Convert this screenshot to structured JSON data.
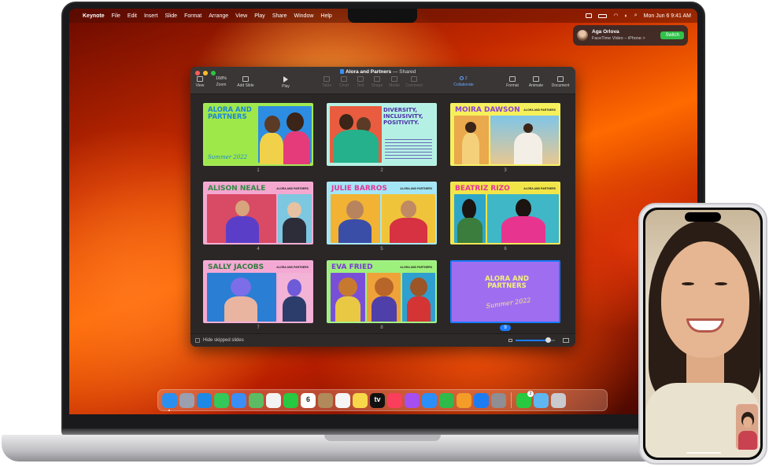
{
  "menubar": {
    "items": [
      "Keynote",
      "File",
      "Edit",
      "Insert",
      "Slide",
      "Format",
      "Arrange",
      "View",
      "Play",
      "Share",
      "Window",
      "Help"
    ],
    "datetime": "Mon Jun 6  9:41 AM"
  },
  "notification": {
    "name": "Aga Orlova",
    "subtitle": "FaceTime Video – iPhone >",
    "button": "Switch"
  },
  "keynote": {
    "title": "Alora and Partners",
    "shared": "— Shared",
    "zoom": "168%",
    "toolbar": {
      "view": "View",
      "zoom": "Zoom",
      "add_slide": "Add Slide",
      "play": "Play",
      "table": "Table",
      "chart": "Chart",
      "text": "Text",
      "shape": "Shape",
      "media": "Media",
      "comment": "Comment",
      "collab_count": "2",
      "collaborate": "Collaborate",
      "format": "Format",
      "animate": "Animate",
      "document": "Document"
    },
    "slides": [
      {
        "num": "1",
        "title": "ALORA AND PARTNERS",
        "caption": "Summer 2022",
        "bg": "#9ee84a",
        "title_color": "#1d86d8"
      },
      {
        "num": "2",
        "title": "DIVERSITY, INCLUSIVITY, POSITIVITY.",
        "bg": "#b4f1e4",
        "title_color": "#4a2fa6"
      },
      {
        "num": "3",
        "title": "MOIRA DAWSON",
        "tag": "ALORA AND PARTNERS",
        "bg": "#f6f05a",
        "title_color": "#8b41d8"
      },
      {
        "num": "4",
        "title": "ALISON NEALE",
        "tag": "ALORA AND PARTNERS",
        "bg": "#f4a7cf",
        "title_color": "#2f8a45"
      },
      {
        "num": "5",
        "title": "JULIE BARROS",
        "tag": "ALORA AND PARTNERS",
        "bg": "#a3e6f5",
        "title_color": "#e2349a"
      },
      {
        "num": "6",
        "title": "BEATRIZ RIZO",
        "tag": "ALORA AND PARTNERS",
        "bg": "#f2e548",
        "title_color": "#e2349a"
      },
      {
        "num": "7",
        "title": "SALLY JACOBS",
        "tag": "ALORA AND PARTNERS",
        "bg": "#f3a9d4",
        "title_color": "#2f7a3c"
      },
      {
        "num": "8",
        "title": "EVA FRIED",
        "tag": "ALORA AND PARTNERS",
        "bg": "#9ef07c",
        "title_color": "#7a3bd6"
      },
      {
        "num": "9",
        "title": "ALORA AND PARTNERS",
        "caption": "Summer 2022",
        "bg": "#9f6ef0",
        "title_color": "#f3f07a"
      }
    ],
    "selected_slide": "9",
    "footer_checkbox": "Hide skipped slides",
    "zoom_slider_value": 0.82
  },
  "dock": {
    "apps": [
      {
        "name": "Finder",
        "color": "#2b8ff0"
      },
      {
        "name": "Launchpad",
        "color": "#9aa0ae"
      },
      {
        "name": "Safari",
        "color": "#1e88e5"
      },
      {
        "name": "Messages",
        "color": "#34c759"
      },
      {
        "name": "Mail",
        "color": "#3a8ef5"
      },
      {
        "name": "Maps",
        "color": "#5dbb63"
      },
      {
        "name": "Photos",
        "color": "#f2f2f2"
      },
      {
        "name": "FaceTime",
        "color": "#28c840"
      },
      {
        "name": "Calendar",
        "color": "#ffffff",
        "label": "6"
      },
      {
        "name": "Contacts",
        "color": "#b08a5b"
      },
      {
        "name": "Reminders",
        "color": "#f5f5f5"
      },
      {
        "name": "Notes",
        "color": "#f8d74a"
      },
      {
        "name": "TV",
        "color": "#111111",
        "label": "tv"
      },
      {
        "name": "Music",
        "color": "#fa3e5b"
      },
      {
        "name": "Podcasts",
        "color": "#a54ff0"
      },
      {
        "name": "Keynote",
        "color": "#2c8ef8"
      },
      {
        "name": "Numbers",
        "color": "#2fba4a"
      },
      {
        "name": "Pages",
        "color": "#f39c27"
      },
      {
        "name": "App Store",
        "color": "#1d7cf2"
      },
      {
        "name": "System Settings",
        "color": "#8e8e93"
      }
    ],
    "extras": [
      {
        "name": "FaceTime-active",
        "color": "#28c840",
        "badge": "2"
      },
      {
        "name": "Downloads",
        "color": "#5fb7f2"
      },
      {
        "name": "Trash",
        "color": "#c9c9ce"
      }
    ]
  },
  "colors": {
    "accent": "#1a7bff",
    "switch": "#30c14a"
  }
}
